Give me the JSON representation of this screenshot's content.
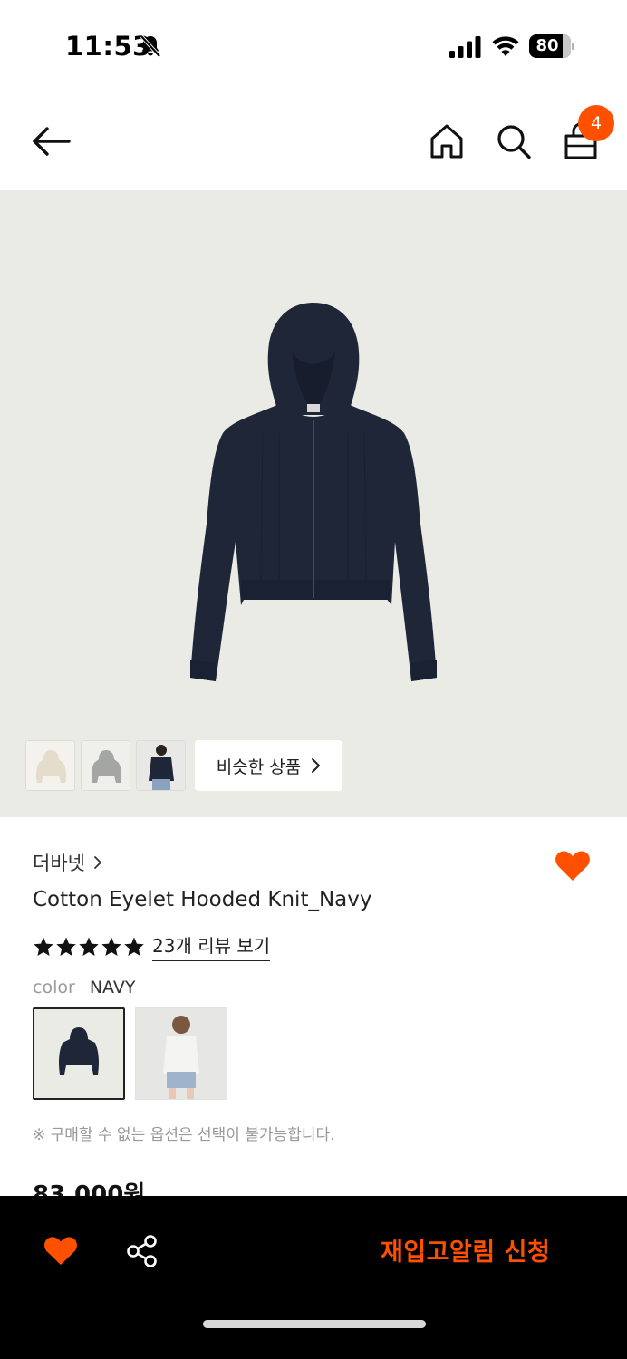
{
  "status_bar": {
    "time": "11:53",
    "battery_percent": "80",
    "battery_level": 0.8,
    "icons": [
      "bell-slash-icon",
      "cellular-signal-icon",
      "wifi-icon",
      "battery-icon"
    ]
  },
  "nav": {
    "icons": [
      "arrow-left-icon",
      "home-icon",
      "search-icon",
      "shopping-bag-icon"
    ],
    "cart_count": "4"
  },
  "gallery": {
    "similar_label": "비슷한 상품",
    "thumbnail_count": 3
  },
  "product": {
    "brand": "더바넷",
    "name": "Cotton Eyelet Hooded Knit_Navy",
    "rating_stars": 5,
    "review_link": "23개 리뷰 보기",
    "color_label": "color",
    "color_value": "NAVY",
    "option_notice": "※ 구매할 수 없는 옵션은 선택이 불가능합니다.",
    "price": "83,000원"
  },
  "bottom_bar": {
    "restock_button": "재입고알림 신청"
  },
  "colors": {
    "accent": "#ff5000",
    "navy": "#1f2638",
    "hero_bg": "#ebebe6"
  }
}
